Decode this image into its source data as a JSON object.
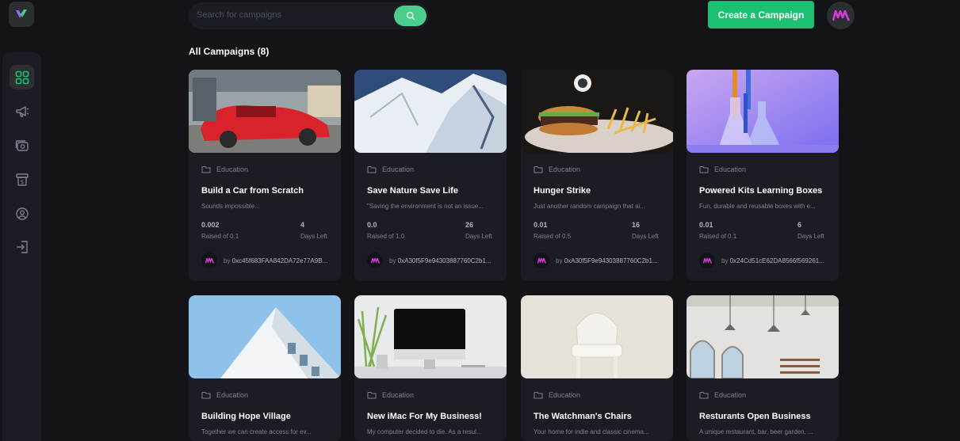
{
  "header": {
    "search_placeholder": "Search for campaigns",
    "create_button": "Create a Campaign"
  },
  "sidebar": {
    "items": [
      {
        "icon": "dashboard-icon",
        "active": true
      },
      {
        "icon": "megaphone-icon",
        "active": false
      },
      {
        "icon": "payment-icon",
        "active": false
      },
      {
        "icon": "withdraw-icon",
        "active": false
      },
      {
        "icon": "profile-icon",
        "active": false
      },
      {
        "icon": "logout-icon",
        "active": false
      }
    ]
  },
  "section": {
    "title": "All Campaigns (8)"
  },
  "colors": {
    "accent": "#1dc071",
    "search_button": "#4acd8d",
    "card_bg": "#1c1c24",
    "page_bg": "#131318",
    "muted": "#808191"
  },
  "campaigns": [
    {
      "category": "Education",
      "title": "Build a Car from Scratch",
      "description": "Sounds impossible...",
      "raised": "0.002",
      "raised_label": "Raised of 0.1",
      "days": "4",
      "days_label": "Days Left",
      "by": "by",
      "owner": "0xc45f683FAA842DA72e77A9B..."
    },
    {
      "category": "Education",
      "title": "Save Nature Save Life",
      "description": "\"Saving the environment is not an issue...",
      "raised": "0.0",
      "raised_label": "Raised of 1.0",
      "days": "26",
      "days_label": "Days Left",
      "by": "by",
      "owner": "0xA30f5F9e94303887760C2b1..."
    },
    {
      "category": "Education",
      "title": "Hunger Strike",
      "description": "Just another random campaign that ai...",
      "raised": "0.01",
      "raised_label": "Raised of 0.5",
      "days": "16",
      "days_label": "Days Left",
      "by": "by",
      "owner": "0xA30f5F9e94303887760C2b1..."
    },
    {
      "category": "Education",
      "title": "Powered Kits Learning Boxes",
      "description": "Fun, durable and reusable boxes with e...",
      "raised": "0.01",
      "raised_label": "Raised of 0.1",
      "days": "6",
      "days_label": "Days Left",
      "by": "by",
      "owner": "0x24Cd51cE62DA8566f569261..."
    },
    {
      "category": "Education",
      "title": "Building Hope Village",
      "description": "Together we can create access for ev..."
    },
    {
      "category": "Education",
      "title": "New iMac For My Business!",
      "description": "My computer decided to die. As a resul..."
    },
    {
      "category": "Education",
      "title": "The Watchman's Chairs",
      "description": "Your home for indie and classic cinema..."
    },
    {
      "category": "Education",
      "title": "Resturants Open Business",
      "description": "A unique restaurant, bar, beer garden, ..."
    }
  ]
}
